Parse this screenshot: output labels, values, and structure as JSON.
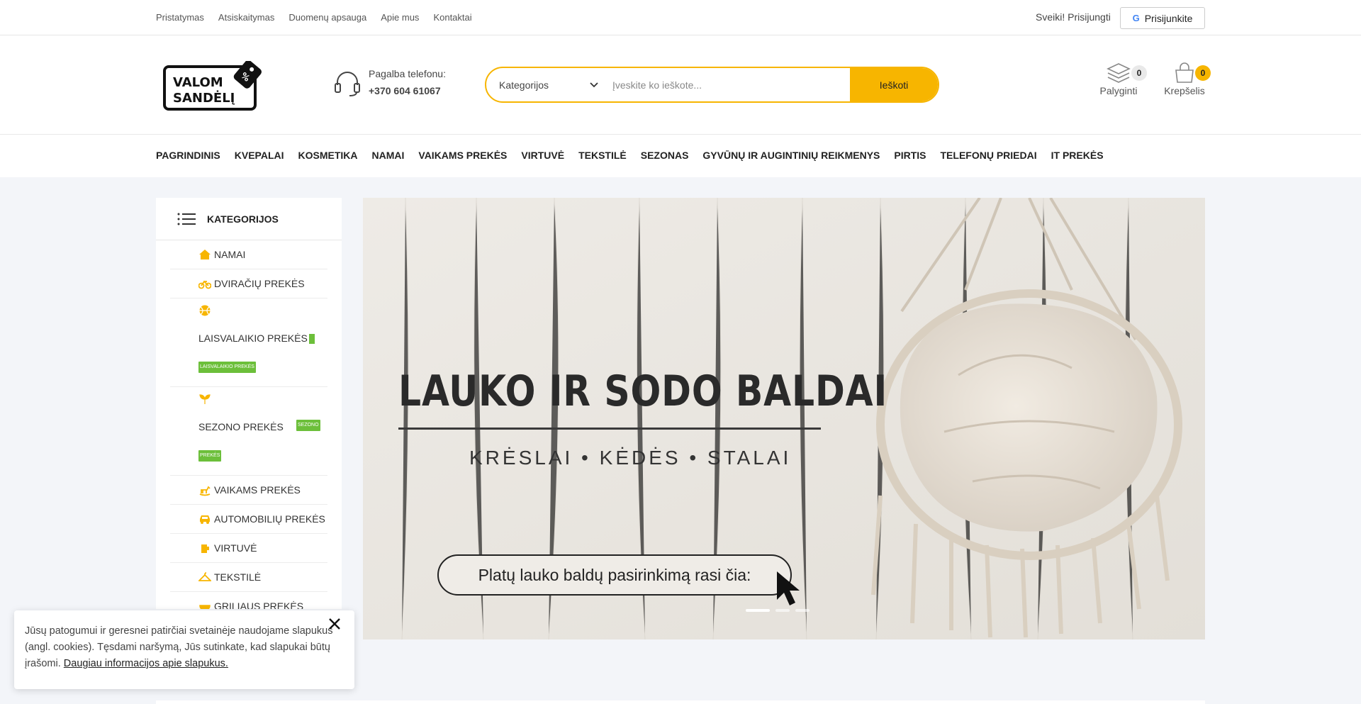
{
  "topbar": {
    "links": [
      "Pristatymas",
      "Atsiskaitymas",
      "Duomenų apsauga",
      "Apie mus",
      "Kontaktai"
    ],
    "greeting": "Sveiki! Prisijungti",
    "google_login_label": "Prisijunkite",
    "google_letter": "G"
  },
  "header": {
    "logo_text_line1": "VALOM",
    "logo_text_line2": "SANDĖLĮ",
    "phone_label": "Pagalba telefonu:",
    "phone_number": "+370 604 61067",
    "search": {
      "category_label": "Kategorijos",
      "placeholder": "Įveskite ko ieškote...",
      "button_label": "Ieškoti"
    },
    "compare": {
      "label": "Palyginti",
      "count": "0"
    },
    "cart": {
      "label": "Krepšelis",
      "count": "0"
    }
  },
  "main_nav": [
    "PAGRINDINIS",
    "KVEPALAI",
    "KOSMETIKA",
    "NAMAI",
    "VAIKAMS PREKĖS",
    "VIRTUVĖ",
    "TEKSTILĖ",
    "SEZONAS",
    "GYVŪNŲ IR AUGINTINIŲ REIKMENYS",
    "PIRTIS",
    "TELEFONŲ PRIEDAI",
    "IT PREKĖS"
  ],
  "sidebar": {
    "title": "KATEGORIJOS",
    "items": [
      {
        "label": "NAMAI",
        "icon": "house-icon"
      },
      {
        "label": "DVIRAČIŲ PREKĖS",
        "icon": "bicycle-icon"
      },
      {
        "label": "LAISVALAIKIO PREKĖS",
        "icon": "ball-icon",
        "tag": "LAISVALAIKIO PREKĖS"
      },
      {
        "label": "SEZONO PREKĖS",
        "icon": "leaf-icon",
        "tag_top": "SEZONO",
        "tag_bottom": "PREKĖS"
      },
      {
        "label": "VAIKAMS PREKĖS",
        "icon": "rocking-horse-icon"
      },
      {
        "label": "AUTOMOBILIŲ PREKĖS",
        "icon": "car-icon"
      },
      {
        "label": "VIRTUVĖ",
        "icon": "jug-icon"
      },
      {
        "label": "TEKSTILĖ",
        "icon": "hanger-icon"
      },
      {
        "label": "GRILIAUS PREKĖS",
        "icon": "grill-icon"
      }
    ]
  },
  "banner": {
    "title": "LAUKO IR SODO BALDAI",
    "subtitle": "KRĖSLAI • KĖDĖS • STALAI",
    "cta": "Platų lauko baldų pasirinkimą rasi čia:"
  },
  "cookie": {
    "text": "Jūsų patogumui ir geresnei patirčiai svetainėje naudojame slapukus (angl. cookies). Tęsdami naršymą, Jūs sutinkate, kad slapukai būtų įrašomi. ",
    "link_text": "Daugiau informacijos apie slapukus."
  },
  "colors": {
    "accent": "#f7b500",
    "tag_green": "#6cbf3a",
    "page_bg": "#f3f5f9"
  }
}
